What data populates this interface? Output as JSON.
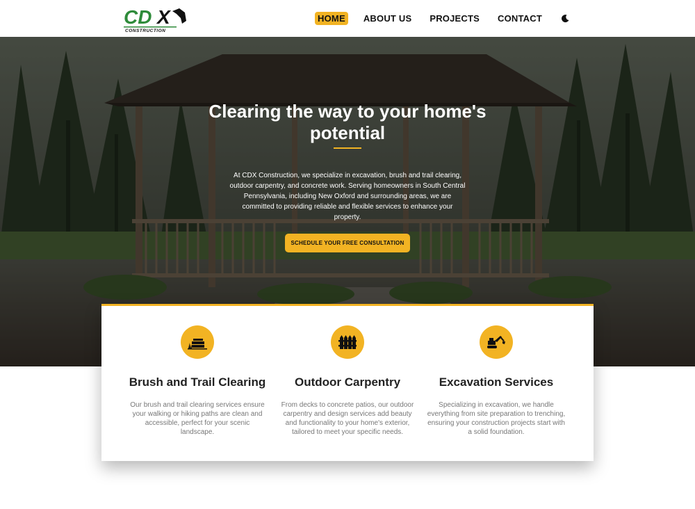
{
  "header": {
    "logo_text": "CDX",
    "logo_subtext": "CONSTRUCTION",
    "nav": [
      {
        "label": "HOME"
      },
      {
        "label": "ABOUT US"
      },
      {
        "label": "PROJECTS"
      },
      {
        "label": "CONTACT"
      }
    ],
    "theme_icon": "moon-icon"
  },
  "hero": {
    "title": "Clearing the way to your home's potential",
    "description": "At CDX Construction, we specialize in excavation, brush and trail clearing, outdoor carpentry, and concrete work. Serving homeowners in South Central Pennsylvania, including New Oxford and surrounding areas, we are committed to providing reliable and flexible services to enhance your property.",
    "cta_label": "SCHEDULE YOUR FREE CONSULTATION"
  },
  "services": [
    {
      "icon": "brush-clearing-icon",
      "title": "Brush and Trail Clearing",
      "text": "Our brush and trail clearing services ensure your walking or hiking paths are clean and accessible, perfect for your scenic landscape."
    },
    {
      "icon": "fence-icon",
      "title": "Outdoor Carpentry",
      "text": "From decks to concrete patios, our outdoor carpentry and design services add beauty and functionality to your home's exterior, tailored to meet your specific needs."
    },
    {
      "icon": "excavator-icon",
      "title": "Excavation Services",
      "text": "Specializing in excavation, we handle everything from site preparation to trenching, ensuring your construction projects start with a solid foundation."
    }
  ],
  "colors": {
    "accent": "#f2b323",
    "logo_green": "#2e8b3a",
    "text_dark": "#222222",
    "text_muted": "#777777"
  }
}
